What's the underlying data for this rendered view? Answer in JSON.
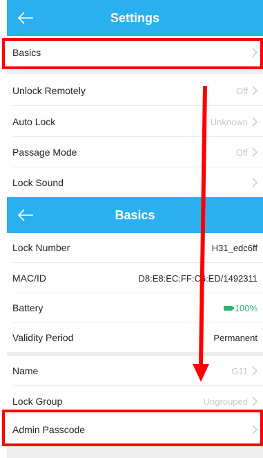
{
  "settings": {
    "title": "Settings",
    "rows": [
      {
        "label": "Basics",
        "value": ""
      },
      {
        "label": "Unlock Remotely",
        "value": "Off"
      },
      {
        "label": "Auto Lock",
        "value": "Unknown"
      },
      {
        "label": "Passage Mode",
        "value": "Off"
      },
      {
        "label": "Lock Sound",
        "value": ""
      }
    ]
  },
  "basics": {
    "title": "Basics",
    "rows": [
      {
        "label": "Lock Number",
        "value": "H31_edc6ff"
      },
      {
        "label": "MAC/ID",
        "value": "D8:E8:EC:FF:C6:ED/1492311"
      },
      {
        "label": "Battery",
        "value": "100%"
      },
      {
        "label": "Validity Period",
        "value": "Permanent"
      },
      {
        "label": "Name",
        "value": "G11"
      },
      {
        "label": "Lock Group",
        "value": "Ungrouped"
      },
      {
        "label": "Admin Passcode",
        "value": ""
      }
    ]
  },
  "icons": {
    "back": "back-arrow-icon",
    "chevron": "chevron-right-icon",
    "battery": "battery-icon"
  },
  "colors": {
    "header": "#2bb0ef",
    "highlight": "#ff0000",
    "battery_text": "#2bb673"
  }
}
